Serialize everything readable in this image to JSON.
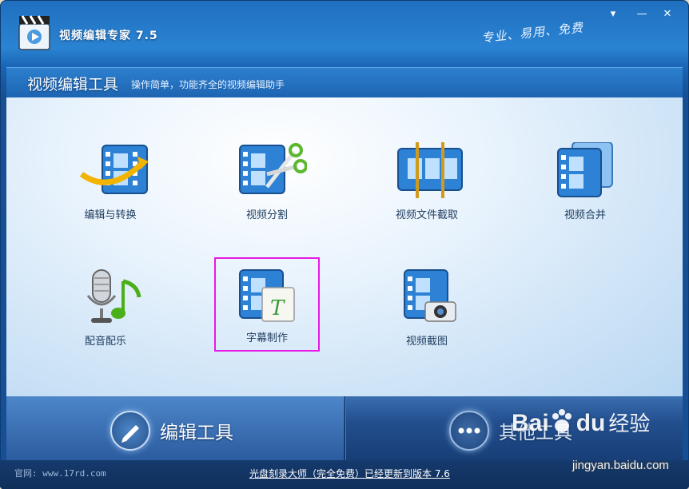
{
  "window": {
    "title": "视频编辑专家 7.5",
    "slogan": "专业、易用、免费",
    "controls": {
      "menu": "▾",
      "minimize": "—",
      "close": "✕"
    }
  },
  "header": {
    "title": "视频编辑工具",
    "subtitle": "操作简单，功能齐全的视频编辑助手"
  },
  "tools": [
    {
      "label": "编辑与转换",
      "icon": "film-convert-icon"
    },
    {
      "label": "视频分割",
      "icon": "film-scissors-icon"
    },
    {
      "label": "视频文件截取",
      "icon": "film-clip-icon"
    },
    {
      "label": "视频合并",
      "icon": "film-merge-icon"
    },
    {
      "label": "配音配乐",
      "icon": "microphone-music-icon"
    },
    {
      "label": "字幕制作",
      "icon": "film-subtitle-icon",
      "selected": true
    },
    {
      "label": "视频截图",
      "icon": "film-camera-icon"
    }
  ],
  "bottom_tabs": [
    {
      "label": "编辑工具",
      "icon": "pencil-icon",
      "active": true
    },
    {
      "label": "其他工具",
      "icon": "more-dots-icon",
      "active": false
    }
  ],
  "status": {
    "site": "官网: www.17rd.com",
    "update": "光盘刻录大师（完全免费）已经更新到版本 7.6"
  },
  "watermark": {
    "brand": "Bai",
    "brand_mid": "du",
    "brand_cn": "经验",
    "url": "jingyan.baidu.com"
  },
  "colors": {
    "accent": "#1f6fbf",
    "selection": "#e619e6"
  }
}
